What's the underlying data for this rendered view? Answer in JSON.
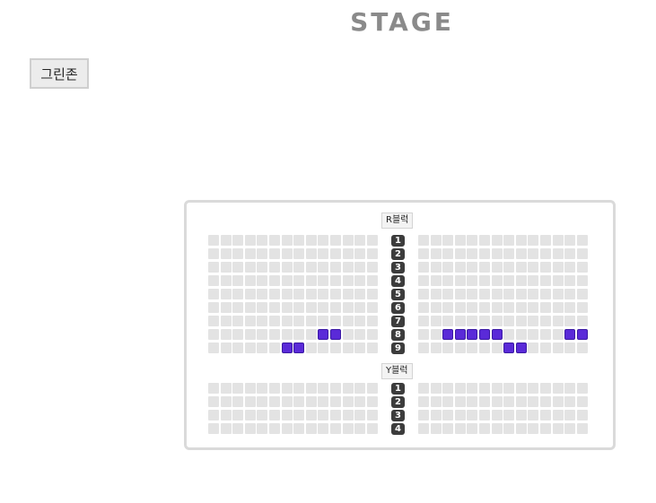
{
  "stage": {
    "title": "STAGE"
  },
  "zone_button": {
    "label": "그린존"
  },
  "blocks": [
    {
      "name": "R블럭",
      "rows": [
        "1",
        "2",
        "3",
        "4",
        "5",
        "6",
        "7",
        "8",
        "9"
      ],
      "left_seats_per_row": 14,
      "right_seats_per_row": 14,
      "available_seats": [
        {
          "row": "8",
          "side": "left",
          "seats": [
            10,
            11
          ]
        },
        {
          "row": "9",
          "side": "left",
          "seats": [
            7,
            8
          ]
        },
        {
          "row": "8",
          "side": "right",
          "seats": [
            3,
            4,
            5,
            6,
            7,
            13,
            14
          ]
        },
        {
          "row": "9",
          "side": "right",
          "seats": [
            8,
            9
          ]
        }
      ]
    },
    {
      "name": "Y블럭",
      "rows": [
        "1",
        "2",
        "3",
        "4"
      ],
      "left_seats_per_row": 14,
      "right_seats_per_row": 14,
      "available_seats": []
    }
  ],
  "colors": {
    "seat_unavailable": "#e3e3e3",
    "seat_available": "#5a2ad8",
    "row_label_bg": "#3c3c3c",
    "stage_text": "#8a8a8a"
  }
}
